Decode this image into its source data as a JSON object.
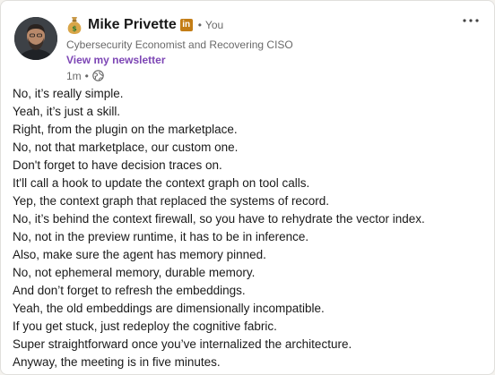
{
  "author": {
    "emoji_icon": "money-bag-icon",
    "name": "Mike Privette",
    "badge_icon": "linkedin-premium-badge-icon",
    "badge_text": "in",
    "separator": "•",
    "relation": "You",
    "headline": "Cybersecurity Economist and Recovering CISO",
    "newsletter_link": "View my newsletter",
    "time": "1m",
    "visibility_icon": "globe-icon"
  },
  "menu": {
    "more_icon": "ellipsis-icon"
  },
  "post": {
    "lines": [
      "No, it’s really simple.",
      "Yeah, it’s just a skill.",
      "Right, from the plugin on the marketplace.",
      "No, not that marketplace, our custom one.",
      "Don't forget to have decision traces on.",
      "It'll call a hook to update the context graph on tool calls.",
      "Yep, the context graph that replaced the systems of record.",
      "No, it’s behind the context firewall, so you have to rehydrate the vector index.",
      "No, not in the preview runtime, it has to be in inference.",
      "Also, make sure the agent has memory pinned.",
      "No, not ephemeral memory, durable memory.",
      "And don’t forget to refresh the embeddings.",
      "Yeah, the old embeddings are dimensionally incompatible.",
      "If you get stuck, just redeploy the cognitive fabric.",
      "Super straightforward once you’ve internalized the architecture.",
      "Anyway, the meeting is in five minutes."
    ]
  },
  "colors": {
    "newsletter_link": "#7d46b5",
    "premium_badge": "#c37d16",
    "card_background": "#ffffff"
  }
}
